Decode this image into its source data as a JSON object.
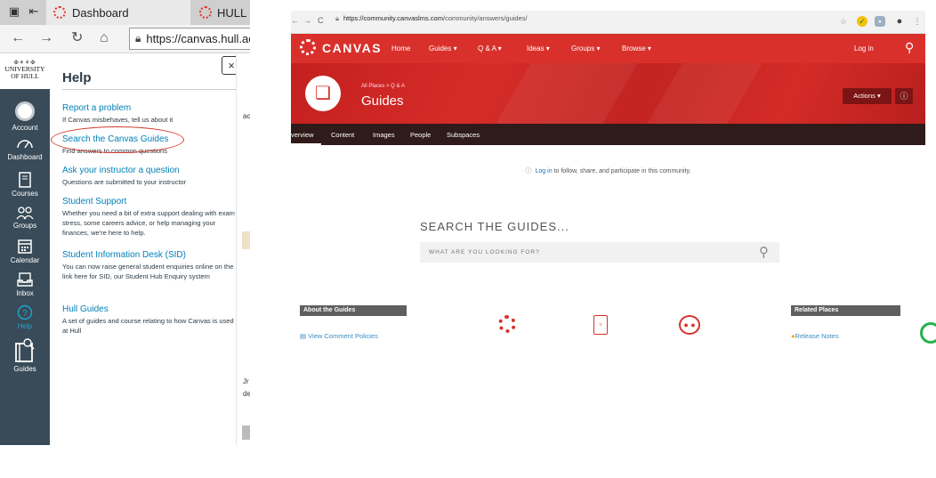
{
  "left_browser": {
    "tab_active_title": "Dashboard",
    "tab_inactive_title": "HULL G",
    "url": "https://canvas.hull.ac.u"
  },
  "uni_logo": {
    "line1": "✠⚜⚘✠",
    "line2": "UNIVERSITY",
    "line3": "OF HULL"
  },
  "global_nav": {
    "items": [
      {
        "label": "Account",
        "icon": "account-icon"
      },
      {
        "label": "Dashboard",
        "icon": "dashboard-icon"
      },
      {
        "label": "Courses",
        "icon": "courses-icon"
      },
      {
        "label": "Groups",
        "icon": "groups-icon"
      },
      {
        "label": "Calendar",
        "icon": "calendar-icon"
      },
      {
        "label": "Inbox",
        "icon": "inbox-icon"
      },
      {
        "label": "Help",
        "icon": "help-icon"
      },
      {
        "label": "Guides",
        "icon": "guides-icon"
      }
    ]
  },
  "help_panel": {
    "title": "Help",
    "close": "×",
    "items": [
      {
        "link": "Report a problem",
        "desc": "If Canvas misbehaves, tell us about it"
      },
      {
        "link": "Search the Canvas Guides",
        "desc": "Find answers to common questions"
      },
      {
        "link": "Ask your instructor a question",
        "desc": "Questions are submitted to your instructor"
      },
      {
        "link": "Student Support",
        "desc": "Whether you need a bit of extra support dealing with exam stress, some careers advice, or help managing your finances, we're here to help."
      },
      {
        "link": "Student Information Desk (SID)",
        "desc": "You can now raise general student enquiries online on the link here for SID, our Student Hub Enquiry system"
      },
      {
        "link": "Hull Guides",
        "desc": "A set of guides and course relating to how Canvas is used at Hull"
      }
    ]
  },
  "left_edge_fragments": [
    "ac",
    "Jr",
    "de"
  ],
  "right_browser": {
    "url_domain": "https://community.canvaslms.com",
    "url_path": "/community/answers/guides/"
  },
  "canvas_site": {
    "brand": "CANVAS",
    "topnav": [
      "Home",
      "Guides ▾",
      "Q & A ▾",
      "Ideas ▾",
      "Groups ▾",
      "Browse ▾"
    ],
    "login": "Log in",
    "breadcrumb": "All Places > Q & A",
    "page_title": "Guides",
    "actions": "Actions ▾",
    "info": "ⓘ",
    "subnav": [
      "verview",
      "Content",
      "Images",
      "People",
      "Subspaces"
    ],
    "login_note_link": "Log in",
    "login_note_rest": " to follow, share, and participate in this community.",
    "search_heading": "SEARCH THE GUIDES...",
    "search_placeholder": "WHAT ARE YOU LOOKING FOR?",
    "about_header": "About the Guides",
    "about_link": "View Comment Policies",
    "related_header": "Related Places",
    "related_link": "Release Notes"
  },
  "colors": {
    "canvas_red": "#d9302b",
    "sidenav_bg": "#394b58",
    "link_blue": "#0081b8",
    "oval_red": "#d13c2e"
  }
}
